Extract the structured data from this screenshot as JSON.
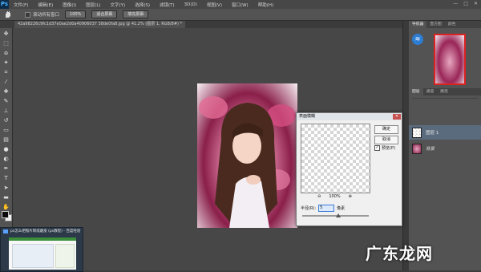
{
  "app": {
    "logo": "Ps"
  },
  "menu": [
    "文件(F)",
    "编辑(E)",
    "图像(I)",
    "图层(L)",
    "文字(Y)",
    "选择(S)",
    "滤镜(T)",
    "3D(D)",
    "视图(V)",
    "窗口(W)",
    "帮助(H)"
  ],
  "window_controls": [
    "—",
    "□",
    "✕"
  ],
  "options": {
    "tool_icon": "hand-icon",
    "scroll_all": "滚动所有窗口",
    "buttons": [
      "100%",
      "适合屏幕",
      "填充屏幕"
    ]
  },
  "document": {
    "tab_title": "42a98226c9fc1d37e0ae2d0a40906037 38de0fa8.jpg @ 41.2% (图层 1, RGB/8#) *"
  },
  "panels": {
    "top_tabs": [
      "导航器",
      "直方图",
      "颜色"
    ],
    "layer_tabs": [
      "图层",
      "通道",
      "路径"
    ],
    "layers": [
      {
        "name": "图层 1",
        "selected": true
      },
      {
        "name": "背景",
        "selected": false
      }
    ]
  },
  "dialog": {
    "title": "表面模糊",
    "ok": "确定",
    "cancel": "取消",
    "preview_label": "预览(P)",
    "preview_checked": "✓",
    "zoom_out": "⊖",
    "zoom_in": "⊕",
    "zoom_level": "100%",
    "radius_label": "半径(R):",
    "radius_value": "5",
    "radius_unit": "像素",
    "close": "✕"
  },
  "popup": {
    "title": "ps怎么把照片转成磨皮 (ps教程) - 百度经验"
  },
  "watermark": "广东龙网",
  "colors": {
    "accent": "#2d7dd2",
    "selection": "#5a6b7d"
  }
}
